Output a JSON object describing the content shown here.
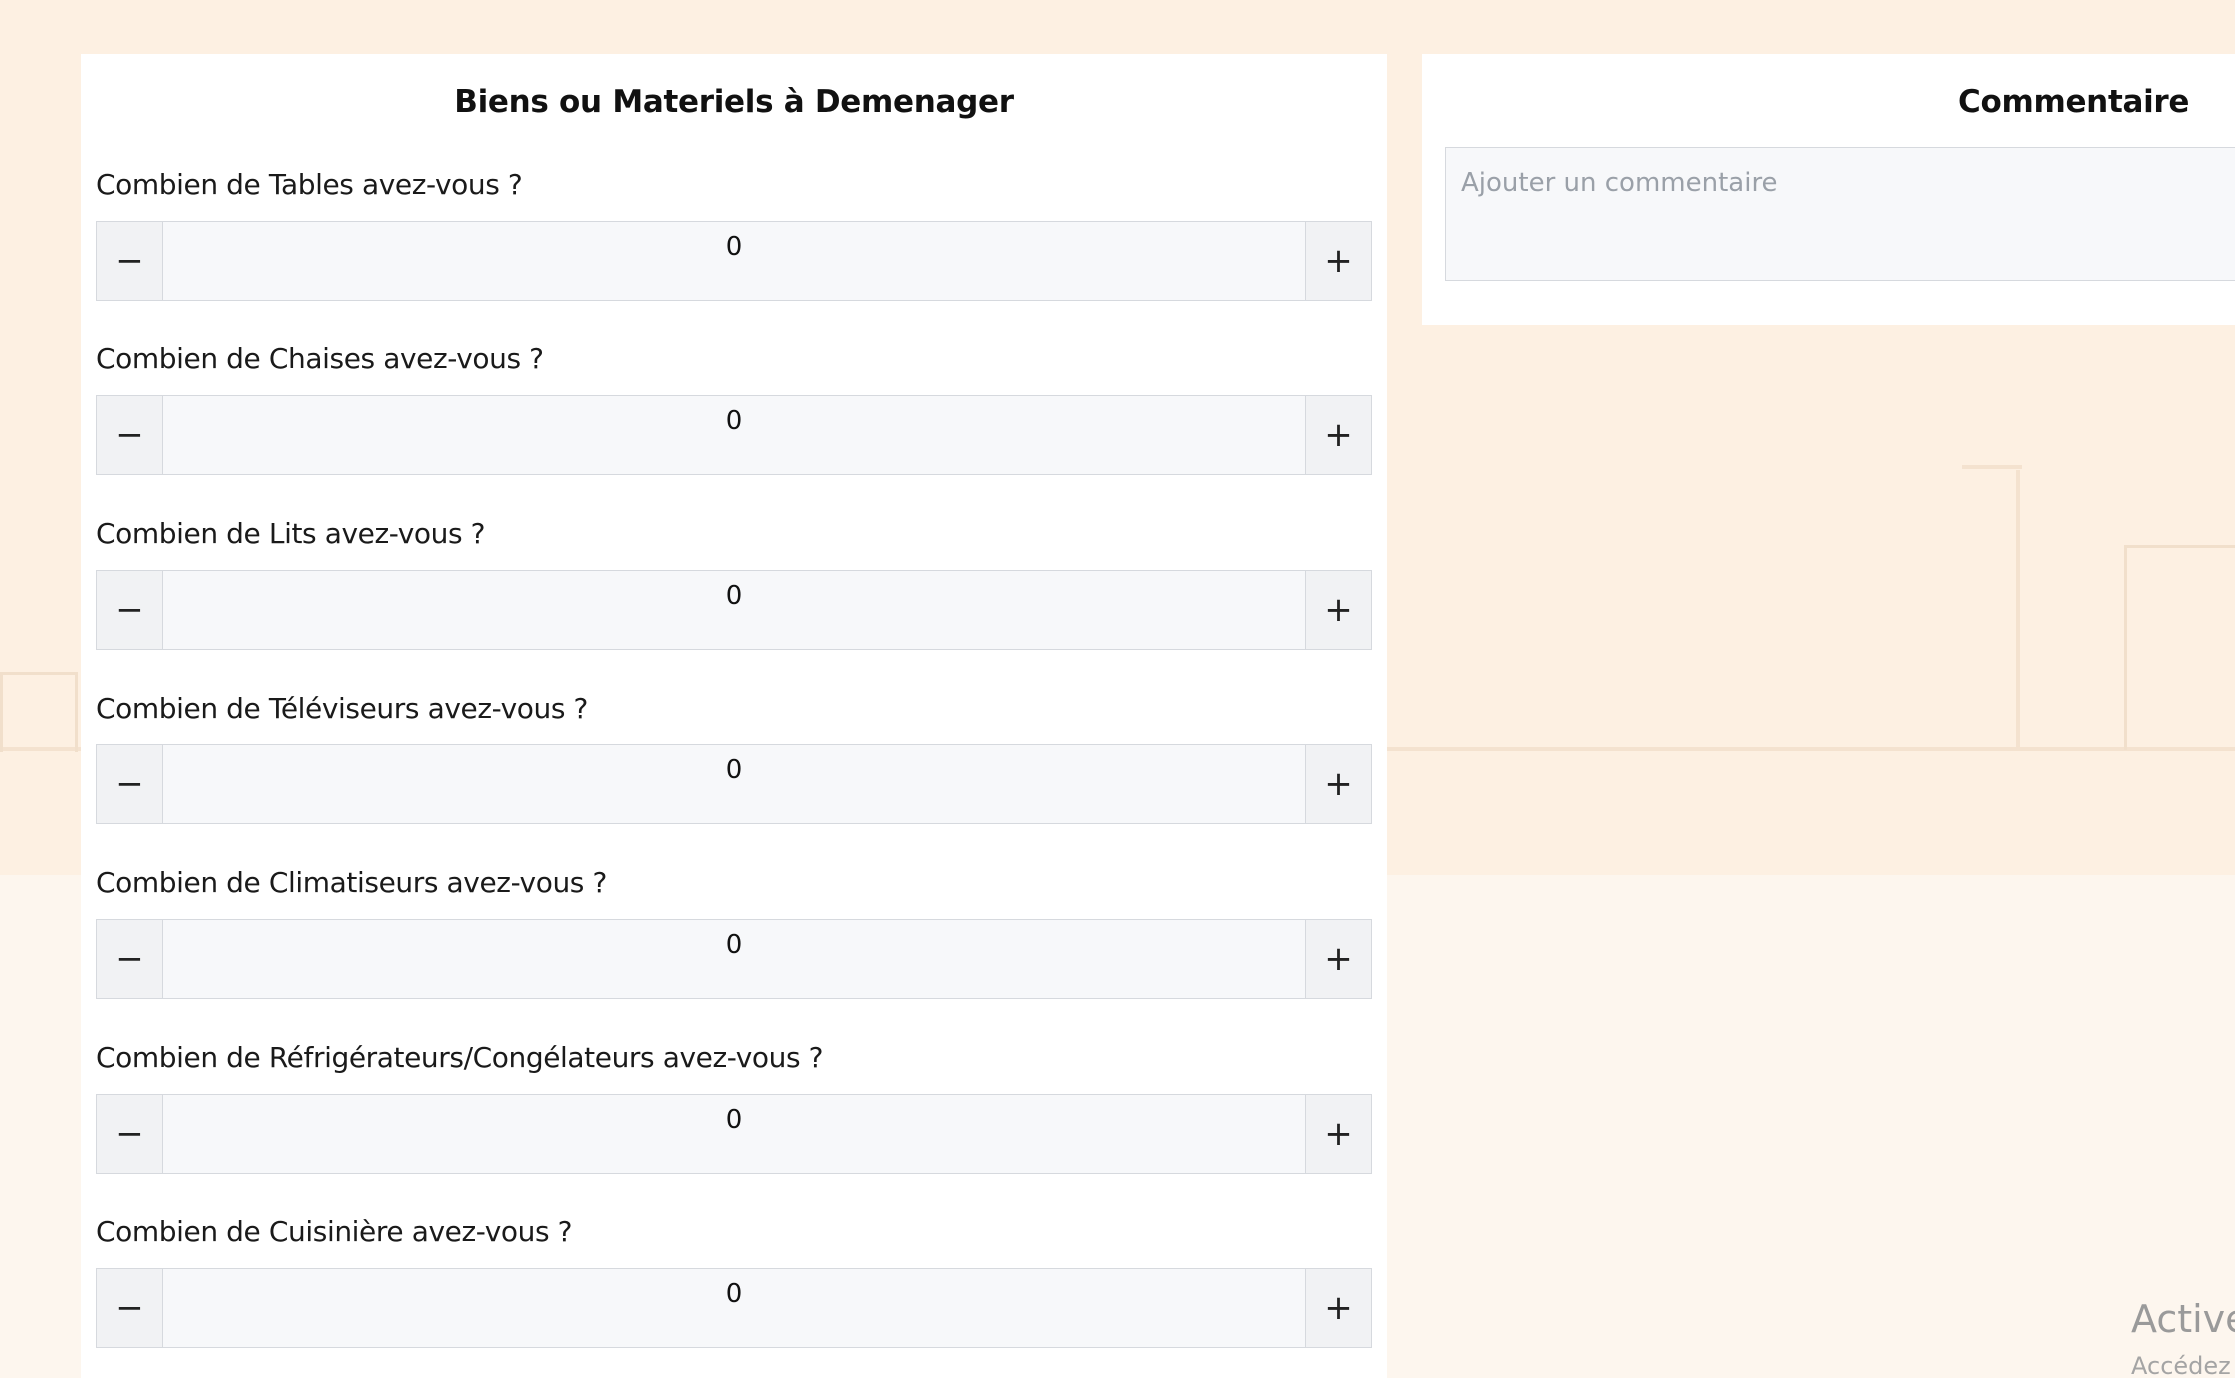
{
  "left_panel": {
    "title": "Biens ou Materiels à Demenager",
    "items": [
      {
        "question": "Combien de Tables avez-vous ?",
        "value": "0",
        "minus": "−",
        "plus": "+"
      },
      {
        "question": "Combien de Chaises avez-vous ?",
        "value": "0",
        "minus": "−",
        "plus": "+"
      },
      {
        "question": "Combien de Lits avez-vous ?",
        "value": "0",
        "minus": "−",
        "plus": "+"
      },
      {
        "question": "Combien de Téléviseurs avez-vous ?",
        "value": "0",
        "minus": "−",
        "plus": "+"
      },
      {
        "question": "Combien de Climatiseurs avez-vous ?",
        "value": "0",
        "minus": "−",
        "plus": "+"
      },
      {
        "question": "Combien de Réfrigérateurs/Congélateurs avez-vous ?",
        "value": "0",
        "minus": "−",
        "plus": "+"
      },
      {
        "question": "Combien de Cuisinière avez-vous ?",
        "value": "0",
        "minus": "−",
        "plus": "+"
      }
    ]
  },
  "right_panel": {
    "title": "Commentaire",
    "comment_placeholder": "Ajouter un commentaire",
    "comment_value": ""
  },
  "watermark": {
    "line1": "Active",
    "line2": "Accédez"
  },
  "colors": {
    "page_background": "#fdf6ee",
    "panel_background": "#ffffff",
    "input_background": "#f7f8fa",
    "border": "#d6d9de",
    "placeholder_text": "#9aa0a8"
  }
}
